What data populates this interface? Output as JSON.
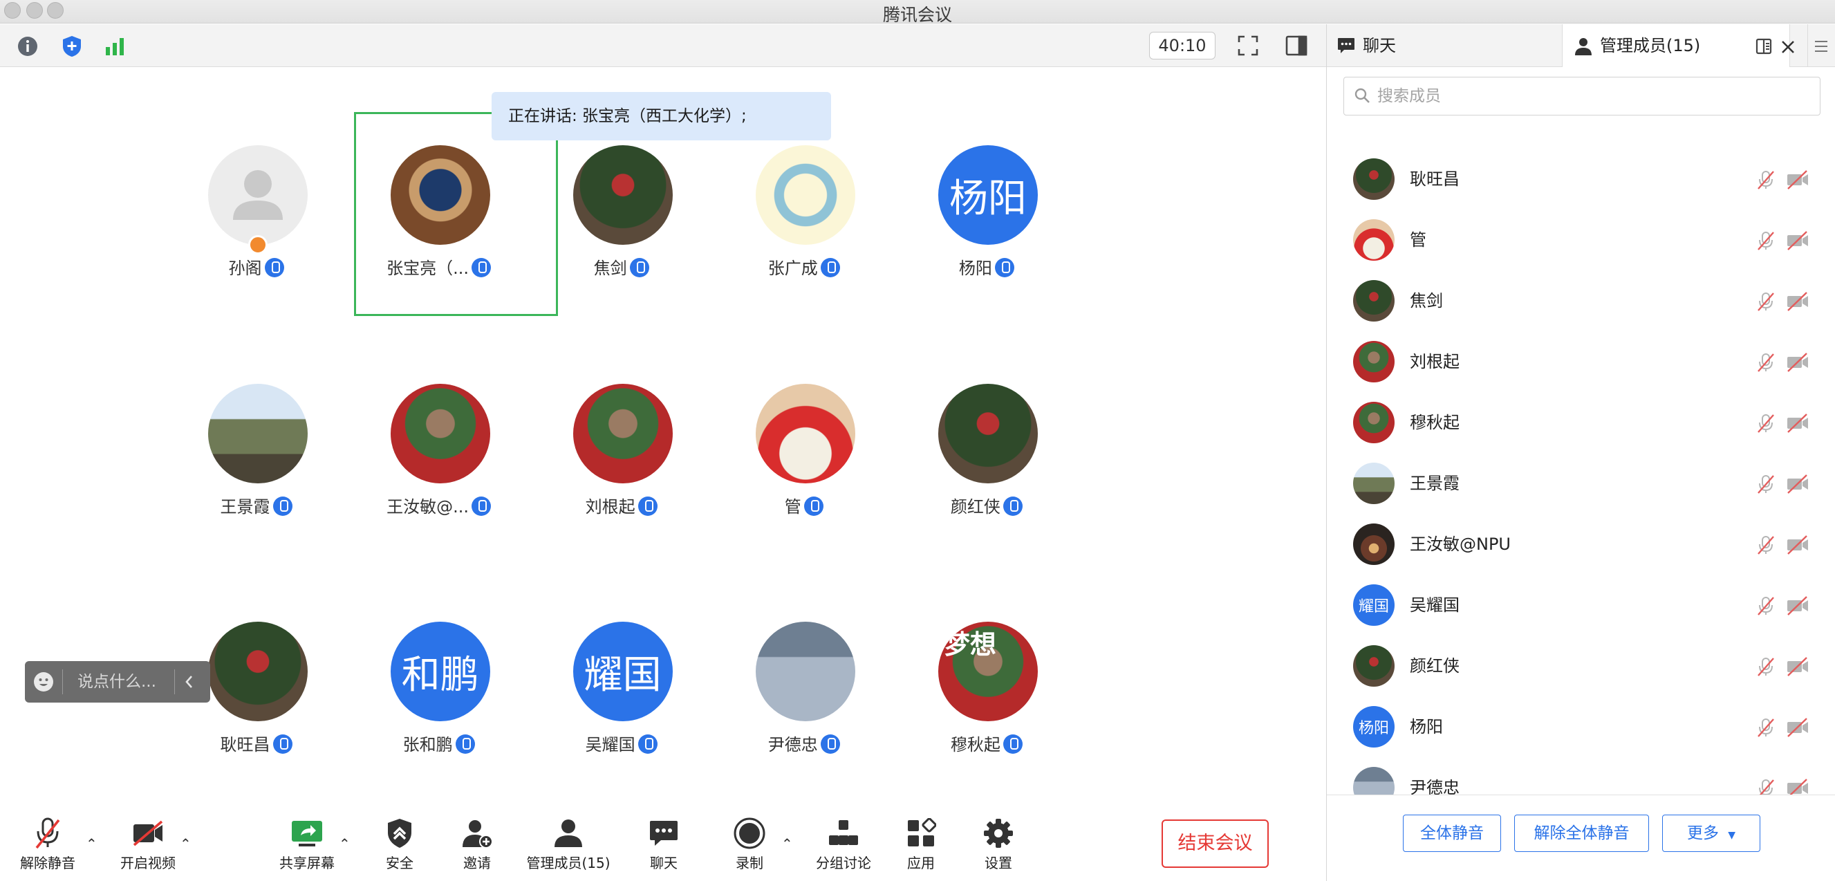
{
  "window": {
    "title": "腾讯会议"
  },
  "topbar": {
    "timer": "40:10"
  },
  "speaking": {
    "text": "正在讲话: 张宝亮（西工大化学）;"
  },
  "participants": [
    {
      "name": "孙阁",
      "avatar": "placeholder"
    },
    {
      "name": "张宝亮（...",
      "avatar": "photo"
    },
    {
      "name": "焦剑",
      "avatar": "photo"
    },
    {
      "name": "张广成",
      "avatar": "photo"
    },
    {
      "name": "杨阳",
      "avatar": "text",
      "avatar_text": "杨阳"
    },
    {
      "name": "王景霞",
      "avatar": "photo"
    },
    {
      "name": "王汝敏@...",
      "avatar": "photo"
    },
    {
      "name": "刘根起",
      "avatar": "photo"
    },
    {
      "name": "管",
      "avatar": "photo"
    },
    {
      "name": "颜红侠",
      "avatar": "photo"
    },
    {
      "name": "耿旺昌",
      "avatar": "photo"
    },
    {
      "name": "张和鹏",
      "avatar": "text",
      "avatar_text": "和鹏"
    },
    {
      "name": "吴耀国",
      "avatar": "text",
      "avatar_text": "耀国"
    },
    {
      "name": "尹德忠",
      "avatar": "photo"
    },
    {
      "name": "穆秋起",
      "avatar": "photo",
      "avatar_text": "梦想"
    }
  ],
  "comment": {
    "placeholder": "说点什么..."
  },
  "bottombar": {
    "unmute": "解除静音",
    "video": "开启视频",
    "share": "共享屏幕",
    "security": "安全",
    "invite": "邀请",
    "members": "管理成员(15)",
    "chat": "聊天",
    "record": "录制",
    "breakout": "分组讨论",
    "apps": "应用",
    "settings": "设置",
    "end": "结束会议"
  },
  "panel": {
    "tab_chat": "聊天",
    "tab_members": "管理成员(15)",
    "search_placeholder": "搜索成员",
    "members": [
      {
        "name": "耿旺昌",
        "avatar": "photo"
      },
      {
        "name": "管",
        "avatar": "photo"
      },
      {
        "name": "焦剑",
        "avatar": "photo"
      },
      {
        "name": "刘根起",
        "avatar": "photo"
      },
      {
        "name": "穆秋起",
        "avatar": "photo"
      },
      {
        "name": "王景霞",
        "avatar": "photo"
      },
      {
        "name": "王汝敏@NPU",
        "avatar": "photo"
      },
      {
        "name": "吴耀国",
        "avatar": "text",
        "avatar_text": "耀国"
      },
      {
        "name": "颜红侠",
        "avatar": "photo"
      },
      {
        "name": "杨阳",
        "avatar": "text",
        "avatar_text": "杨阳"
      },
      {
        "name": "尹德忠",
        "avatar": "photo"
      }
    ],
    "mute_all": "全体静音",
    "unmute_all": "解除全体静音",
    "more": "更多"
  },
  "colors": {
    "accent": "#2b73e8",
    "end": "#e53935",
    "active_frame": "#3cb65a"
  }
}
